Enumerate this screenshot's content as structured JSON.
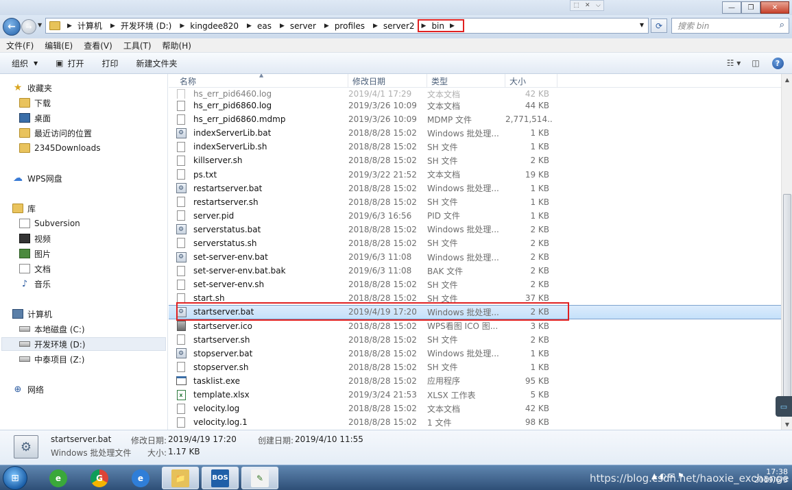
{
  "window": {
    "minimize": "—",
    "maximize": "❐",
    "close": "✕",
    "mini_controls": [
      "⬚",
      "✕",
      "⌵"
    ]
  },
  "address": {
    "crumbs": [
      "计算机",
      "开发环境 (D:)",
      "kingdee820",
      "eas",
      "server",
      "profiles",
      "server2"
    ],
    "current": "bin",
    "search_placeholder": "搜索 bin"
  },
  "menu": [
    "文件(F)",
    "编辑(E)",
    "查看(V)",
    "工具(T)",
    "帮助(H)"
  ],
  "toolbar": {
    "organize": "组织",
    "open": "打开",
    "print": "打印",
    "new_folder": "新建文件夹"
  },
  "sidebar": {
    "favorites_title": "收藏夹",
    "favorites": [
      "下载",
      "桌面",
      "最近访问的位置",
      "2345Downloads"
    ],
    "wps": "WPS网盘",
    "libraries_title": "库",
    "libraries": [
      "Subversion",
      "视频",
      "图片",
      "文档",
      "音乐"
    ],
    "computer_title": "计算机",
    "drives": [
      "本地磁盘 (C:)",
      "开发环境 (D:)",
      "中泰项目 (Z:)"
    ],
    "network": "网络"
  },
  "columns": {
    "name": "名称",
    "date": "修改日期",
    "type": "类型",
    "size": "大小"
  },
  "partial_row": {
    "name": "hs_err_pid6460.log",
    "date": "2019/4/1 17:29",
    "type": "文本文档",
    "size": "42 KB"
  },
  "files": [
    {
      "name": "hs_err_pid6860.log",
      "date": "2019/3/26 10:09",
      "type": "文本文档",
      "size": "44 KB",
      "icon": "doc"
    },
    {
      "name": "hs_err_pid6860.mdmp",
      "date": "2019/3/26 10:09",
      "type": "MDMP 文件",
      "size": "2,771,514...",
      "icon": "doc"
    },
    {
      "name": "indexServerLib.bat",
      "date": "2018/8/28 15:02",
      "type": "Windows 批处理...",
      "size": "1 KB",
      "icon": "bat"
    },
    {
      "name": "indexServerLib.sh",
      "date": "2018/8/28 15:02",
      "type": "SH 文件",
      "size": "1 KB",
      "icon": "doc"
    },
    {
      "name": "killserver.sh",
      "date": "2018/8/28 15:02",
      "type": "SH 文件",
      "size": "2 KB",
      "icon": "doc"
    },
    {
      "name": "ps.txt",
      "date": "2019/3/22 21:52",
      "type": "文本文档",
      "size": "19 KB",
      "icon": "doc"
    },
    {
      "name": "restartserver.bat",
      "date": "2018/8/28 15:02",
      "type": "Windows 批处理...",
      "size": "1 KB",
      "icon": "bat"
    },
    {
      "name": "restartserver.sh",
      "date": "2018/8/28 15:02",
      "type": "SH 文件",
      "size": "1 KB",
      "icon": "doc"
    },
    {
      "name": "server.pid",
      "date": "2019/6/3 16:56",
      "type": "PID 文件",
      "size": "1 KB",
      "icon": "doc"
    },
    {
      "name": "serverstatus.bat",
      "date": "2018/8/28 15:02",
      "type": "Windows 批处理...",
      "size": "2 KB",
      "icon": "bat"
    },
    {
      "name": "serverstatus.sh",
      "date": "2018/8/28 15:02",
      "type": "SH 文件",
      "size": "2 KB",
      "icon": "doc"
    },
    {
      "name": "set-server-env.bat",
      "date": "2019/6/3 11:08",
      "type": "Windows 批处理...",
      "size": "2 KB",
      "icon": "bat"
    },
    {
      "name": "set-server-env.bat.bak",
      "date": "2019/6/3 11:08",
      "type": "BAK 文件",
      "size": "2 KB",
      "icon": "doc"
    },
    {
      "name": "set-server-env.sh",
      "date": "2018/8/28 15:02",
      "type": "SH 文件",
      "size": "2 KB",
      "icon": "doc"
    },
    {
      "name": "start.sh",
      "date": "2018/8/28 15:02",
      "type": "SH 文件",
      "size": "37 KB",
      "icon": "doc"
    },
    {
      "name": "startserver.bat",
      "date": "2019/4/19 17:20",
      "type": "Windows 批处理...",
      "size": "2 KB",
      "icon": "bat",
      "selected": true
    },
    {
      "name": "startserver.ico",
      "date": "2018/8/28 15:02",
      "type": "WPS看图 ICO 图...",
      "size": "3 KB",
      "icon": "ico"
    },
    {
      "name": "startserver.sh",
      "date": "2018/8/28 15:02",
      "type": "SH 文件",
      "size": "2 KB",
      "icon": "doc"
    },
    {
      "name": "stopserver.bat",
      "date": "2018/8/28 15:02",
      "type": "Windows 批处理...",
      "size": "1 KB",
      "icon": "bat"
    },
    {
      "name": "stopserver.sh",
      "date": "2018/8/28 15:02",
      "type": "SH 文件",
      "size": "1 KB",
      "icon": "doc"
    },
    {
      "name": "tasklist.exe",
      "date": "2018/8/28 15:02",
      "type": "应用程序",
      "size": "95 KB",
      "icon": "exe"
    },
    {
      "name": "template.xlsx",
      "date": "2019/3/24 21:53",
      "type": "XLSX 工作表",
      "size": "5 KB",
      "icon": "xls"
    },
    {
      "name": "velocity.log",
      "date": "2018/8/28 15:02",
      "type": "文本文档",
      "size": "42 KB",
      "icon": "doc"
    },
    {
      "name": "velocity.log.1",
      "date": "2018/8/28 15:02",
      "type": "1 文件",
      "size": "98 KB",
      "icon": "doc"
    }
  ],
  "details": {
    "name": "startserver.bat",
    "type": "Windows 批处理文件",
    "modified_label": "修改日期:",
    "modified": "2019/4/19 17:20",
    "size_label": "大小:",
    "size": "1.17 KB",
    "created_label": "创建日期:",
    "created": "2019/4/10 11:55"
  },
  "taskbar": {
    "apps": [
      "e",
      "G",
      "e",
      "📁",
      "BOS",
      "✎"
    ],
    "time": "17:38",
    "date": "2019/6/3"
  },
  "watermark": "https://blog.csdn.net/haoxie_exchange",
  "colors": {
    "selection": "#c4e0fa",
    "highlight_box": "#e02020",
    "taskbar": "#2e4f77"
  }
}
